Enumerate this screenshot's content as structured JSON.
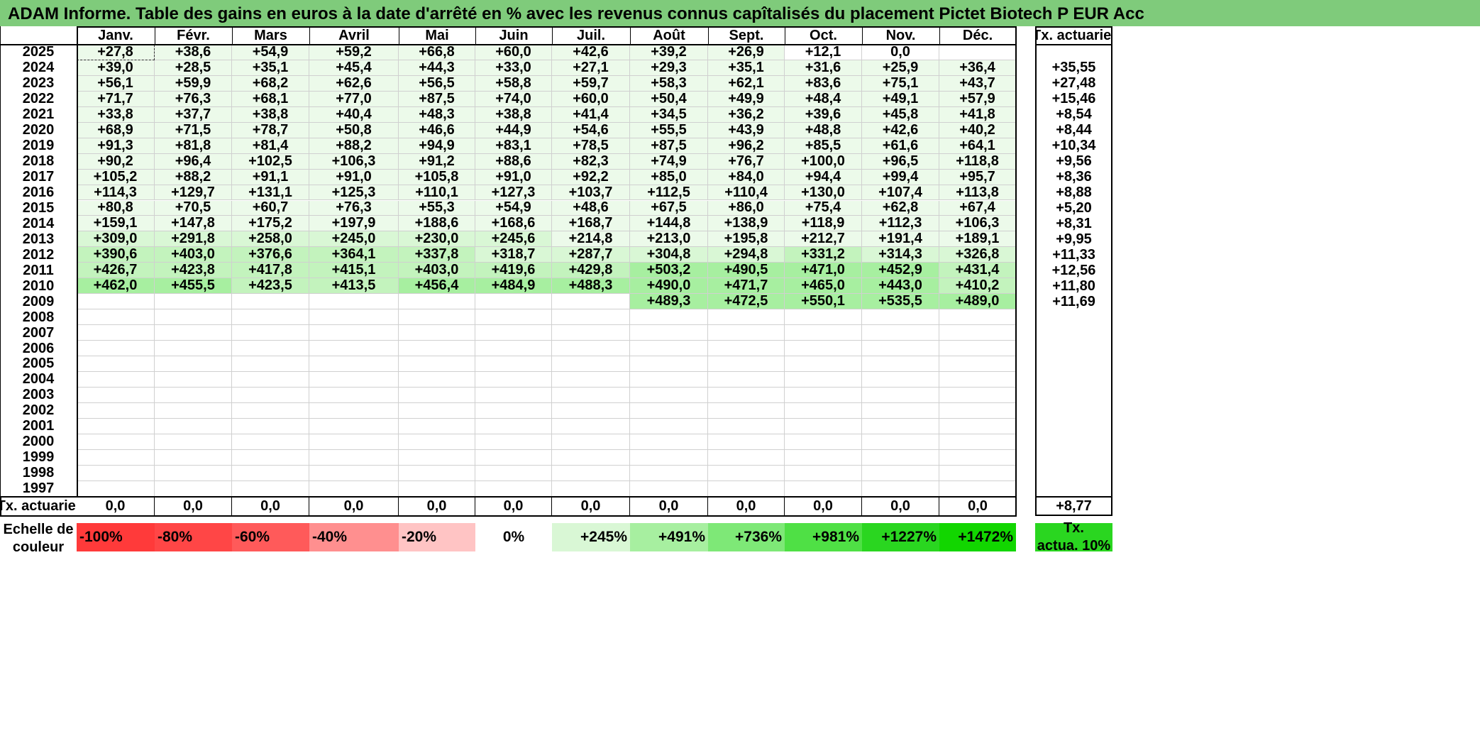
{
  "title": "ADAM Informe. Table des gains en euros à la date d'arrêté en % avec les revenus connus capîtalisés du placement Pictet Biotech P EUR Acc",
  "colors": {
    "title_bg": "#7fcb7b",
    "green_scale": [
      "#ffffff",
      "#ecfaea",
      "#d9f7d5",
      "#c3f3bd",
      "#a7efa0",
      "#7ee877",
      "#4fe045",
      "#12d600"
    ],
    "red_scale": [
      "#ffc4c4",
      "#ff8f8f",
      "#ff5a5a",
      "#ff4646",
      "#ff3a3a"
    ],
    "legend_rate_bg": "#2ad620"
  },
  "chart_data": {
    "type": "table",
    "title": "ADAM Informe. Table des gains en euros à la date d'arrêté en % avec les revenus connus capîtalisés du placement Pictet Biotech P EUR Acc",
    "columns": [
      "Janv.",
      "Févr.",
      "Mars",
      "Avril",
      "Mai",
      "Juin",
      "Juil.",
      "Août",
      "Sept.",
      "Oct.",
      "Nov.",
      "Déc."
    ],
    "rate_header": "Tx. actuariel",
    "rows": [
      {
        "year": "2025",
        "values": [
          "+27,8",
          "+38,6",
          "+54,9",
          "+59,2",
          "+66,8",
          "+60,0",
          "+42,6",
          "+39,2",
          "+26,9",
          "+12,1",
          "0,0",
          ""
        ],
        "rate": ""
      },
      {
        "year": "2024",
        "values": [
          "+39,0",
          "+28,5",
          "+35,1",
          "+45,4",
          "+44,3",
          "+33,0",
          "+27,1",
          "+29,3",
          "+35,1",
          "+31,6",
          "+25,9",
          "+36,4"
        ],
        "rate": "+35,55"
      },
      {
        "year": "2023",
        "values": [
          "+56,1",
          "+59,9",
          "+68,2",
          "+62,6",
          "+56,5",
          "+58,8",
          "+59,7",
          "+58,3",
          "+62,1",
          "+83,6",
          "+75,1",
          "+43,7"
        ],
        "rate": "+27,48"
      },
      {
        "year": "2022",
        "values": [
          "+71,7",
          "+76,3",
          "+68,1",
          "+77,0",
          "+87,5",
          "+74,0",
          "+60,0",
          "+50,4",
          "+49,9",
          "+48,4",
          "+49,1",
          "+57,9"
        ],
        "rate": "+15,46"
      },
      {
        "year": "2021",
        "values": [
          "+33,8",
          "+37,7",
          "+38,8",
          "+40,4",
          "+48,3",
          "+38,8",
          "+41,4",
          "+34,5",
          "+36,2",
          "+39,6",
          "+45,8",
          "+41,8"
        ],
        "rate": "+8,54"
      },
      {
        "year": "2020",
        "values": [
          "+68,9",
          "+71,5",
          "+78,7",
          "+50,8",
          "+46,6",
          "+44,9",
          "+54,6",
          "+55,5",
          "+43,9",
          "+48,8",
          "+42,6",
          "+40,2"
        ],
        "rate": "+8,44"
      },
      {
        "year": "2019",
        "values": [
          "+91,3",
          "+81,8",
          "+81,4",
          "+88,2",
          "+94,9",
          "+83,1",
          "+78,5",
          "+87,5",
          "+96,2",
          "+85,5",
          "+61,6",
          "+64,1"
        ],
        "rate": "+10,34"
      },
      {
        "year": "2018",
        "values": [
          "+90,2",
          "+96,4",
          "+102,5",
          "+106,3",
          "+91,2",
          "+88,6",
          "+82,3",
          "+74,9",
          "+76,7",
          "+100,0",
          "+96,5",
          "+118,8"
        ],
        "rate": "+9,56"
      },
      {
        "year": "2017",
        "values": [
          "+105,2",
          "+88,2",
          "+91,1",
          "+91,0",
          "+105,8",
          "+91,0",
          "+92,2",
          "+85,0",
          "+84,0",
          "+94,4",
          "+99,4",
          "+95,7"
        ],
        "rate": "+8,36"
      },
      {
        "year": "2016",
        "values": [
          "+114,3",
          "+129,7",
          "+131,1",
          "+125,3",
          "+110,1",
          "+127,3",
          "+103,7",
          "+112,5",
          "+110,4",
          "+130,0",
          "+107,4",
          "+113,8"
        ],
        "rate": "+8,88"
      },
      {
        "year": "2015",
        "values": [
          "+80,8",
          "+70,5",
          "+60,7",
          "+76,3",
          "+55,3",
          "+54,9",
          "+48,6",
          "+67,5",
          "+86,0",
          "+75,4",
          "+62,8",
          "+67,4"
        ],
        "rate": "+5,20"
      },
      {
        "year": "2014",
        "values": [
          "+159,1",
          "+147,8",
          "+175,2",
          "+197,9",
          "+188,6",
          "+168,6",
          "+168,7",
          "+144,8",
          "+138,9",
          "+118,9",
          "+112,3",
          "+106,3"
        ],
        "rate": "+8,31"
      },
      {
        "year": "2013",
        "values": [
          "+309,0",
          "+291,8",
          "+258,0",
          "+245,0",
          "+230,0",
          "+245,6",
          "+214,8",
          "+213,0",
          "+195,8",
          "+212,7",
          "+191,4",
          "+189,1"
        ],
        "rate": "+9,95"
      },
      {
        "year": "2012",
        "values": [
          "+390,6",
          "+403,0",
          "+376,6",
          "+364,1",
          "+337,8",
          "+318,7",
          "+287,7",
          "+304,8",
          "+294,8",
          "+331,2",
          "+314,3",
          "+326,8"
        ],
        "rate": "+11,33"
      },
      {
        "year": "2011",
        "values": [
          "+426,7",
          "+423,8",
          "+417,8",
          "+415,1",
          "+403,0",
          "+419,6",
          "+429,8",
          "+503,2",
          "+490,5",
          "+471,0",
          "+452,9",
          "+431,4"
        ],
        "rate": "+12,56"
      },
      {
        "year": "2010",
        "values": [
          "+462,0",
          "+455,5",
          "+423,5",
          "+413,5",
          "+456,4",
          "+484,9",
          "+488,3",
          "+490,0",
          "+471,7",
          "+465,0",
          "+443,0",
          "+410,2"
        ],
        "rate": "+11,80"
      },
      {
        "year": "2009",
        "values": [
          "",
          "",
          "",
          "",
          "",
          "",
          "",
          "+489,3",
          "+472,5",
          "+550,1",
          "+535,5",
          "+489,0"
        ],
        "rate": "+11,69"
      },
      {
        "year": "2008",
        "values": [
          "",
          "",
          "",
          "",
          "",
          "",
          "",
          "",
          "",
          "",
          "",
          ""
        ],
        "rate": ""
      },
      {
        "year": "2007",
        "values": [
          "",
          "",
          "",
          "",
          "",
          "",
          "",
          "",
          "",
          "",
          "",
          ""
        ],
        "rate": ""
      },
      {
        "year": "2006",
        "values": [
          "",
          "",
          "",
          "",
          "",
          "",
          "",
          "",
          "",
          "",
          "",
          ""
        ],
        "rate": ""
      },
      {
        "year": "2005",
        "values": [
          "",
          "",
          "",
          "",
          "",
          "",
          "",
          "",
          "",
          "",
          "",
          ""
        ],
        "rate": ""
      },
      {
        "year": "2004",
        "values": [
          "",
          "",
          "",
          "",
          "",
          "",
          "",
          "",
          "",
          "",
          "",
          ""
        ],
        "rate": ""
      },
      {
        "year": "2003",
        "values": [
          "",
          "",
          "",
          "",
          "",
          "",
          "",
          "",
          "",
          "",
          "",
          ""
        ],
        "rate": ""
      },
      {
        "year": "2002",
        "values": [
          "",
          "",
          "",
          "",
          "",
          "",
          "",
          "",
          "",
          "",
          "",
          ""
        ],
        "rate": ""
      },
      {
        "year": "2001",
        "values": [
          "",
          "",
          "",
          "",
          "",
          "",
          "",
          "",
          "",
          "",
          "",
          ""
        ],
        "rate": ""
      },
      {
        "year": "2000",
        "values": [
          "",
          "",
          "",
          "",
          "",
          "",
          "",
          "",
          "",
          "",
          "",
          ""
        ],
        "rate": ""
      },
      {
        "year": "1999",
        "values": [
          "",
          "",
          "",
          "",
          "",
          "",
          "",
          "",
          "",
          "",
          "",
          ""
        ],
        "rate": ""
      },
      {
        "year": "1998",
        "values": [
          "",
          "",
          "",
          "",
          "",
          "",
          "",
          "",
          "",
          "",
          "",
          ""
        ],
        "rate": ""
      },
      {
        "year": "1997",
        "values": [
          "",
          "",
          "",
          "",
          "",
          "",
          "",
          "",
          "",
          "",
          "",
          ""
        ],
        "rate": ""
      }
    ],
    "footer": {
      "label": "Tx. actuariel",
      "values": [
        "0,0",
        "0,0",
        "0,0",
        "0,0",
        "0,0",
        "0,0",
        "0,0",
        "0,0",
        "0,0",
        "0,0",
        "0,0",
        "0,0"
      ],
      "rate": "+8,77"
    },
    "color_scale": {
      "label_line1": "Echelle de",
      "label_line2": "couleur",
      "steps": [
        {
          "label": "-100%",
          "value": -100,
          "color": "#ff3a3a"
        },
        {
          "label": "-80%",
          "value": -80,
          "color": "#ff4646"
        },
        {
          "label": "-60%",
          "value": -60,
          "color": "#ff5a5a"
        },
        {
          "label": "-40%",
          "value": -40,
          "color": "#ff8f8f"
        },
        {
          "label": "-20%",
          "value": -20,
          "color": "#ffc4c4"
        },
        {
          "label": "0%",
          "value": 0,
          "color": "#ffffff"
        },
        {
          "label": "+245%",
          "value": 245,
          "color": "#d9f7d5"
        },
        {
          "label": "+491%",
          "value": 491,
          "color": "#a7efa0"
        },
        {
          "label": "+736%",
          "value": 736,
          "color": "#7ee877"
        },
        {
          "label": "+981%",
          "value": 981,
          "color": "#4fe045"
        },
        {
          "label": "+1227%",
          "value": 1227,
          "color": "#2ad620"
        },
        {
          "label": "+1472%",
          "value": 1472,
          "color": "#12d600"
        }
      ],
      "rate_legend_line1": "Tx.",
      "rate_legend_line2": "actua. 10%",
      "rate_legend_color": "#2ad620"
    }
  }
}
